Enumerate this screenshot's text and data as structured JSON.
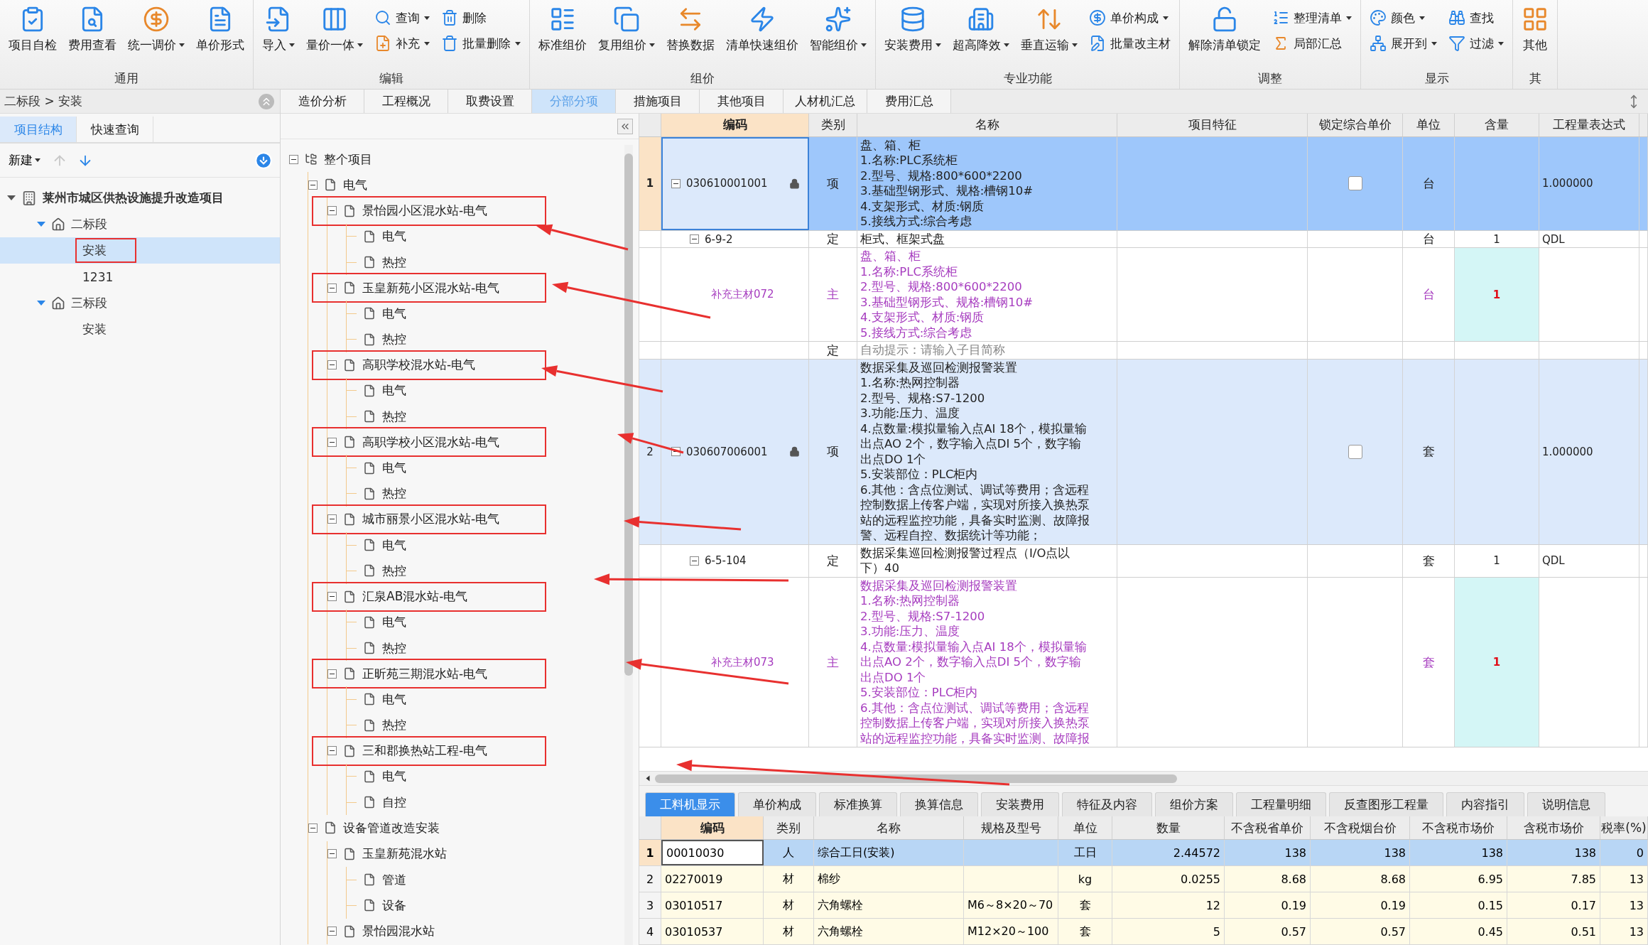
{
  "ribbon": {
    "groups": [
      {
        "label": "通用",
        "items": [
          {
            "label": "项目自检",
            "kind": "large",
            "dropdown": false
          },
          {
            "label": "费用查看",
            "kind": "large",
            "dropdown": false
          },
          {
            "label": "统一调价",
            "kind": "large",
            "dropdown": true
          },
          {
            "label": "单价形式",
            "kind": "large",
            "dropdown": false
          }
        ]
      },
      {
        "label": "编辑",
        "items": [
          {
            "label": "导入",
            "kind": "large",
            "dropdown": true
          },
          {
            "label": "量价一体",
            "kind": "large",
            "dropdown": true
          },
          {
            "label": "查询",
            "kind": "small",
            "dropdown": true
          },
          {
            "label": "补充",
            "kind": "small",
            "dropdown": true
          },
          {
            "label": "删除",
            "kind": "small",
            "dropdown": false
          },
          {
            "label": "批量删除",
            "kind": "small",
            "dropdown": true
          }
        ]
      },
      {
        "label": "组价",
        "items": [
          {
            "label": "标准组价",
            "kind": "large",
            "dropdown": false
          },
          {
            "label": "复用组价",
            "kind": "large",
            "dropdown": true
          },
          {
            "label": "替换数据",
            "kind": "large",
            "dropdown": false
          },
          {
            "label": "清单快速组价",
            "kind": "large",
            "dropdown": false
          },
          {
            "label": "智能组价",
            "kind": "large",
            "dropdown": true
          }
        ]
      },
      {
        "label": "专业功能",
        "items": [
          {
            "label": "安装费用",
            "kind": "large",
            "dropdown": true
          },
          {
            "label": "超高降效",
            "kind": "large",
            "dropdown": true
          },
          {
            "label": "垂直运输",
            "kind": "large",
            "dropdown": true
          },
          {
            "label": "单价构成",
            "kind": "small",
            "dropdown": true
          },
          {
            "label": "批量改主材",
            "kind": "small",
            "dropdown": false
          }
        ]
      },
      {
        "label": "调整",
        "items": [
          {
            "label": "解除清单锁定",
            "kind": "large",
            "dropdown": false
          },
          {
            "label": "整理清单",
            "kind": "small",
            "dropdown": true
          },
          {
            "label": "局部汇总",
            "kind": "small",
            "dropdown": false
          }
        ]
      },
      {
        "label": "显示",
        "items": [
          {
            "label": "颜色",
            "kind": "small",
            "dropdown": true
          },
          {
            "label": "展开到",
            "kind": "small",
            "dropdown": true
          },
          {
            "label": "查找",
            "kind": "small",
            "dropdown": false
          },
          {
            "label": "过滤",
            "kind": "small",
            "dropdown": true
          }
        ]
      },
      {
        "label": "其",
        "items": [
          {
            "label": "其他",
            "kind": "large",
            "dropdown": false
          }
        ]
      }
    ]
  },
  "breadcrumb": "二标段 > 安装",
  "main_tabs": [
    {
      "label": "造价分析",
      "selected": false
    },
    {
      "label": "工程概况",
      "selected": false
    },
    {
      "label": "取费设置",
      "selected": false
    },
    {
      "label": "分部分项",
      "selected": true
    },
    {
      "label": "措施项目",
      "selected": false
    },
    {
      "label": "其他项目",
      "selected": false
    },
    {
      "label": "人材机汇总",
      "selected": false
    },
    {
      "label": "费用汇总",
      "selected": false
    }
  ],
  "left_panel": {
    "tabs": [
      {
        "label": "项目结构",
        "selected": true
      },
      {
        "label": "快速查询",
        "selected": false
      }
    ],
    "new_button": "新建",
    "tree": [
      {
        "label": "莱州市城区供热设施提升改造项目",
        "expanded": true,
        "selected": false,
        "children": [
          {
            "label": "二标段",
            "expanded": true,
            "selected": false,
            "children": [
              {
                "label": "安装",
                "selected": true,
                "annotated": true
              },
              {
                "label": "1231",
                "selected": false
              }
            ]
          },
          {
            "label": "三标段",
            "expanded": true,
            "selected": false,
            "children": [
              {
                "label": "安装",
                "selected": false
              }
            ]
          }
        ]
      }
    ]
  },
  "division_tree": [
    {
      "label": "整个项目",
      "expanded": true,
      "children": [
        {
          "label": "电气",
          "expanded": true,
          "children": [
            {
              "label": "景怡园小区混水站-电气",
              "expanded": true,
              "annotated": true,
              "children": [
                {
                  "label": "电气"
                },
                {
                  "label": "热控"
                }
              ]
            },
            {
              "label": "玉皇新苑小区混水站-电气",
              "expanded": true,
              "annotated": true,
              "children": [
                {
                  "label": "电气"
                },
                {
                  "label": "热控"
                }
              ]
            },
            {
              "label": "高职学校混水站-电气",
              "expanded": true,
              "annotated": true,
              "children": [
                {
                  "label": "电气"
                },
                {
                  "label": "热控"
                }
              ]
            },
            {
              "label": "高职学校小区混水站-电气",
              "expanded": true,
              "annotated": true,
              "children": [
                {
                  "label": "电气"
                },
                {
                  "label": "热控"
                }
              ]
            },
            {
              "label": "城市丽景小区混水站-电气",
              "expanded": true,
              "annotated": true,
              "children": [
                {
                  "label": "电气"
                },
                {
                  "label": "热控"
                }
              ]
            },
            {
              "label": "汇泉AB混水站-电气",
              "expanded": true,
              "annotated": true,
              "children": [
                {
                  "label": "电气"
                },
                {
                  "label": "热控"
                }
              ]
            },
            {
              "label": "正昕苑三期混水站-电气",
              "expanded": true,
              "annotated": true,
              "children": [
                {
                  "label": "电气"
                },
                {
                  "label": "热控"
                }
              ]
            },
            {
              "label": "三和郡换热站工程-电气",
              "expanded": true,
              "annotated": true,
              "children": [
                {
                  "label": "电气"
                },
                {
                  "label": "自控"
                }
              ]
            }
          ]
        },
        {
          "label": "设备管道改造安装",
          "expanded": true,
          "children": [
            {
              "label": "玉皇新苑混水站",
              "expanded": true,
              "children": [
                {
                  "label": "管道"
                },
                {
                  "label": "设备"
                }
              ]
            },
            {
              "label": "景怡园混水站",
              "expanded": true
            }
          ]
        }
      ]
    }
  ],
  "grid": {
    "columns": [
      "编码",
      "类别",
      "名称",
      "项目特征",
      "锁定综合单价",
      "单位",
      "含量",
      "工程量表达式"
    ],
    "rows": [
      {
        "kind": "item",
        "number": "1",
        "code": "030610001001",
        "locked": true,
        "type": "项",
        "name": "盘、箱、柜\n1.名称:PLC系统柜\n2.型号、规格:800*600*2200\n3.基础型钢形式、规格:槽钢10#\n4.支架形式、材质:钢质\n5.接线方式:综合考虑",
        "lock_price": false,
        "unit": "台",
        "expression": "1.000000",
        "selected": true
      },
      {
        "kind": "quota",
        "code": "6-9-2",
        "type": "定",
        "name": "柜式、框架式盘",
        "unit": "台",
        "quantity": "1",
        "expression": "QDL",
        "selected": false
      },
      {
        "kind": "material",
        "code": "补充主材072",
        "type": "主",
        "name": "盘、箱、柜\n1.名称:PLC系统柜\n2.型号、规格:800*600*2200\n3.基础型钢形式、规格:槽钢10#\n4.支架形式、材质:钢质\n5.接线方式:综合考虑",
        "unit": "台",
        "quantity": "1",
        "selected": false
      },
      {
        "kind": "hint",
        "type": "定",
        "name": "自动提示：请输入子目简称",
        "selected": false
      },
      {
        "kind": "item",
        "number": "2",
        "code": "030607006001",
        "locked": true,
        "type": "项",
        "name": "数据采集及巡回检测报警装置\n1.名称:热网控制器\n2.型号、规格:S7-1200\n3.功能:压力、温度\n4.点数量:模拟量输入点AI 18个，模拟量输出点AO 2个，数字输入点DI 5个，数字输出点DO 1个\n5.安装部位：PLC柜内\n6.其他：含点位测试、调试等费用；含远程控制数据上传客户端，实现对所接入换热泵站的远程监控功能，具备实时监测、故障报警、远程自控、数据统计等功能；",
        "lock_price": false,
        "unit": "套",
        "expression": "1.000000",
        "selected": false
      },
      {
        "kind": "quota",
        "code": "6-5-104",
        "type": "定",
        "name": "数据采集巡回检测报警过程点（I/O点以下）40",
        "unit": "套",
        "quantity": "1",
        "expression": "QDL",
        "selected": false
      },
      {
        "kind": "material",
        "code": "补充主材073",
        "type": "主",
        "name": "数据采集及巡回检测报警装置\n1.名称:热网控制器\n2.型号、规格:S7-1200\n3.功能:压力、温度\n4.点数量:模拟量输入点AI 18个，模拟量输出点AO 2个，数字输入点DI 5个，数字输出点DO 1个\n5.安装部位：PLC柜内\n6.其他：含点位测试、调试等费用；含远程控制数据上传客户端，实现对所接入换热泵站的远程监控功能，具备实时监测、故障报",
        "unit": "套",
        "quantity": "1",
        "selected": false
      }
    ]
  },
  "detail_tabs": [
    {
      "label": "工料机显示",
      "selected": true
    },
    {
      "label": "单价构成",
      "selected": false
    },
    {
      "label": "标准换算",
      "selected": false
    },
    {
      "label": "换算信息",
      "selected": false
    },
    {
      "label": "安装费用",
      "selected": false
    },
    {
      "label": "特征及内容",
      "selected": false
    },
    {
      "label": "组价方案",
      "selected": false
    },
    {
      "label": "工程量明细",
      "selected": false
    },
    {
      "label": "反查图形工程量",
      "selected": false
    },
    {
      "label": "内容指引",
      "selected": false
    },
    {
      "label": "说明信息",
      "selected": false
    }
  ],
  "detail_grid": {
    "columns": [
      "编码",
      "类别",
      "名称",
      "规格及型号",
      "单位",
      "数量",
      "不含税省单价",
      "不含税烟台价",
      "不含税市场价",
      "含税市场价",
      "税率(%)"
    ],
    "rows": [
      {
        "number": "1",
        "code": "00010030",
        "type": "人",
        "name": "综合工日(安装)",
        "unit": "工日",
        "quantity": "2.44572",
        "prices": [
          "138",
          "138",
          "138",
          "138"
        ],
        "tax": "0",
        "selected": true
      },
      {
        "number": "2",
        "code": "02270019",
        "type": "材",
        "name": "棉纱",
        "unit": "kg",
        "quantity": "0.0255",
        "prices": [
          "8.68",
          "8.68",
          "6.95",
          "7.85"
        ],
        "tax": "13",
        "selected": false
      },
      {
        "number": "3",
        "code": "03010517",
        "type": "材",
        "name": "六角螺栓",
        "spec": "M6～8×20～70",
        "unit": "套",
        "quantity": "12",
        "prices": [
          "0.19",
          "0.19",
          "0.15",
          "0.17"
        ],
        "tax": "13",
        "selected": false
      },
      {
        "number": "4",
        "code": "03010537",
        "type": "材",
        "name": "六角螺栓",
        "spec": "M12×20～100",
        "unit": "套",
        "quantity": "5",
        "prices": [
          "0.57",
          "0.57",
          "0.45",
          "0.51"
        ],
        "tax": "13",
        "selected": false
      }
    ]
  }
}
